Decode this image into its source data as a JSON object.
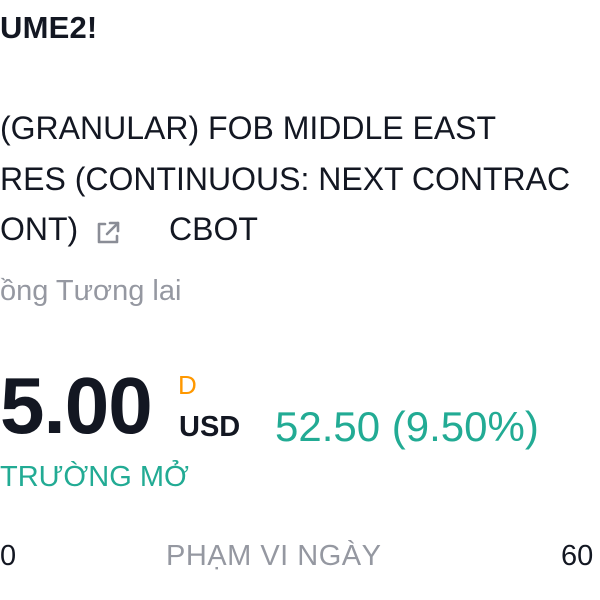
{
  "header": {
    "symbol": "UME2!"
  },
  "description": {
    "line1": "(GRANULAR) FOB MIDDLE EAST",
    "line2": "RES (CONTINUOUS: NEXT CONTRAC",
    "line3": "ONT)"
  },
  "external_link_icon": "external-link-icon",
  "exchange": "CBOT",
  "instrument_type": "ồng Tương lai",
  "quote": {
    "price": "5.00",
    "flag": "D",
    "currency": "USD",
    "change": "52.50 (9.50%)",
    "change_color": "#22ab94",
    "market_status": "TRƯỜNG MỞ"
  },
  "day_range": {
    "low": "0",
    "label": "PHẠM VI NGÀY",
    "high": "60"
  }
}
